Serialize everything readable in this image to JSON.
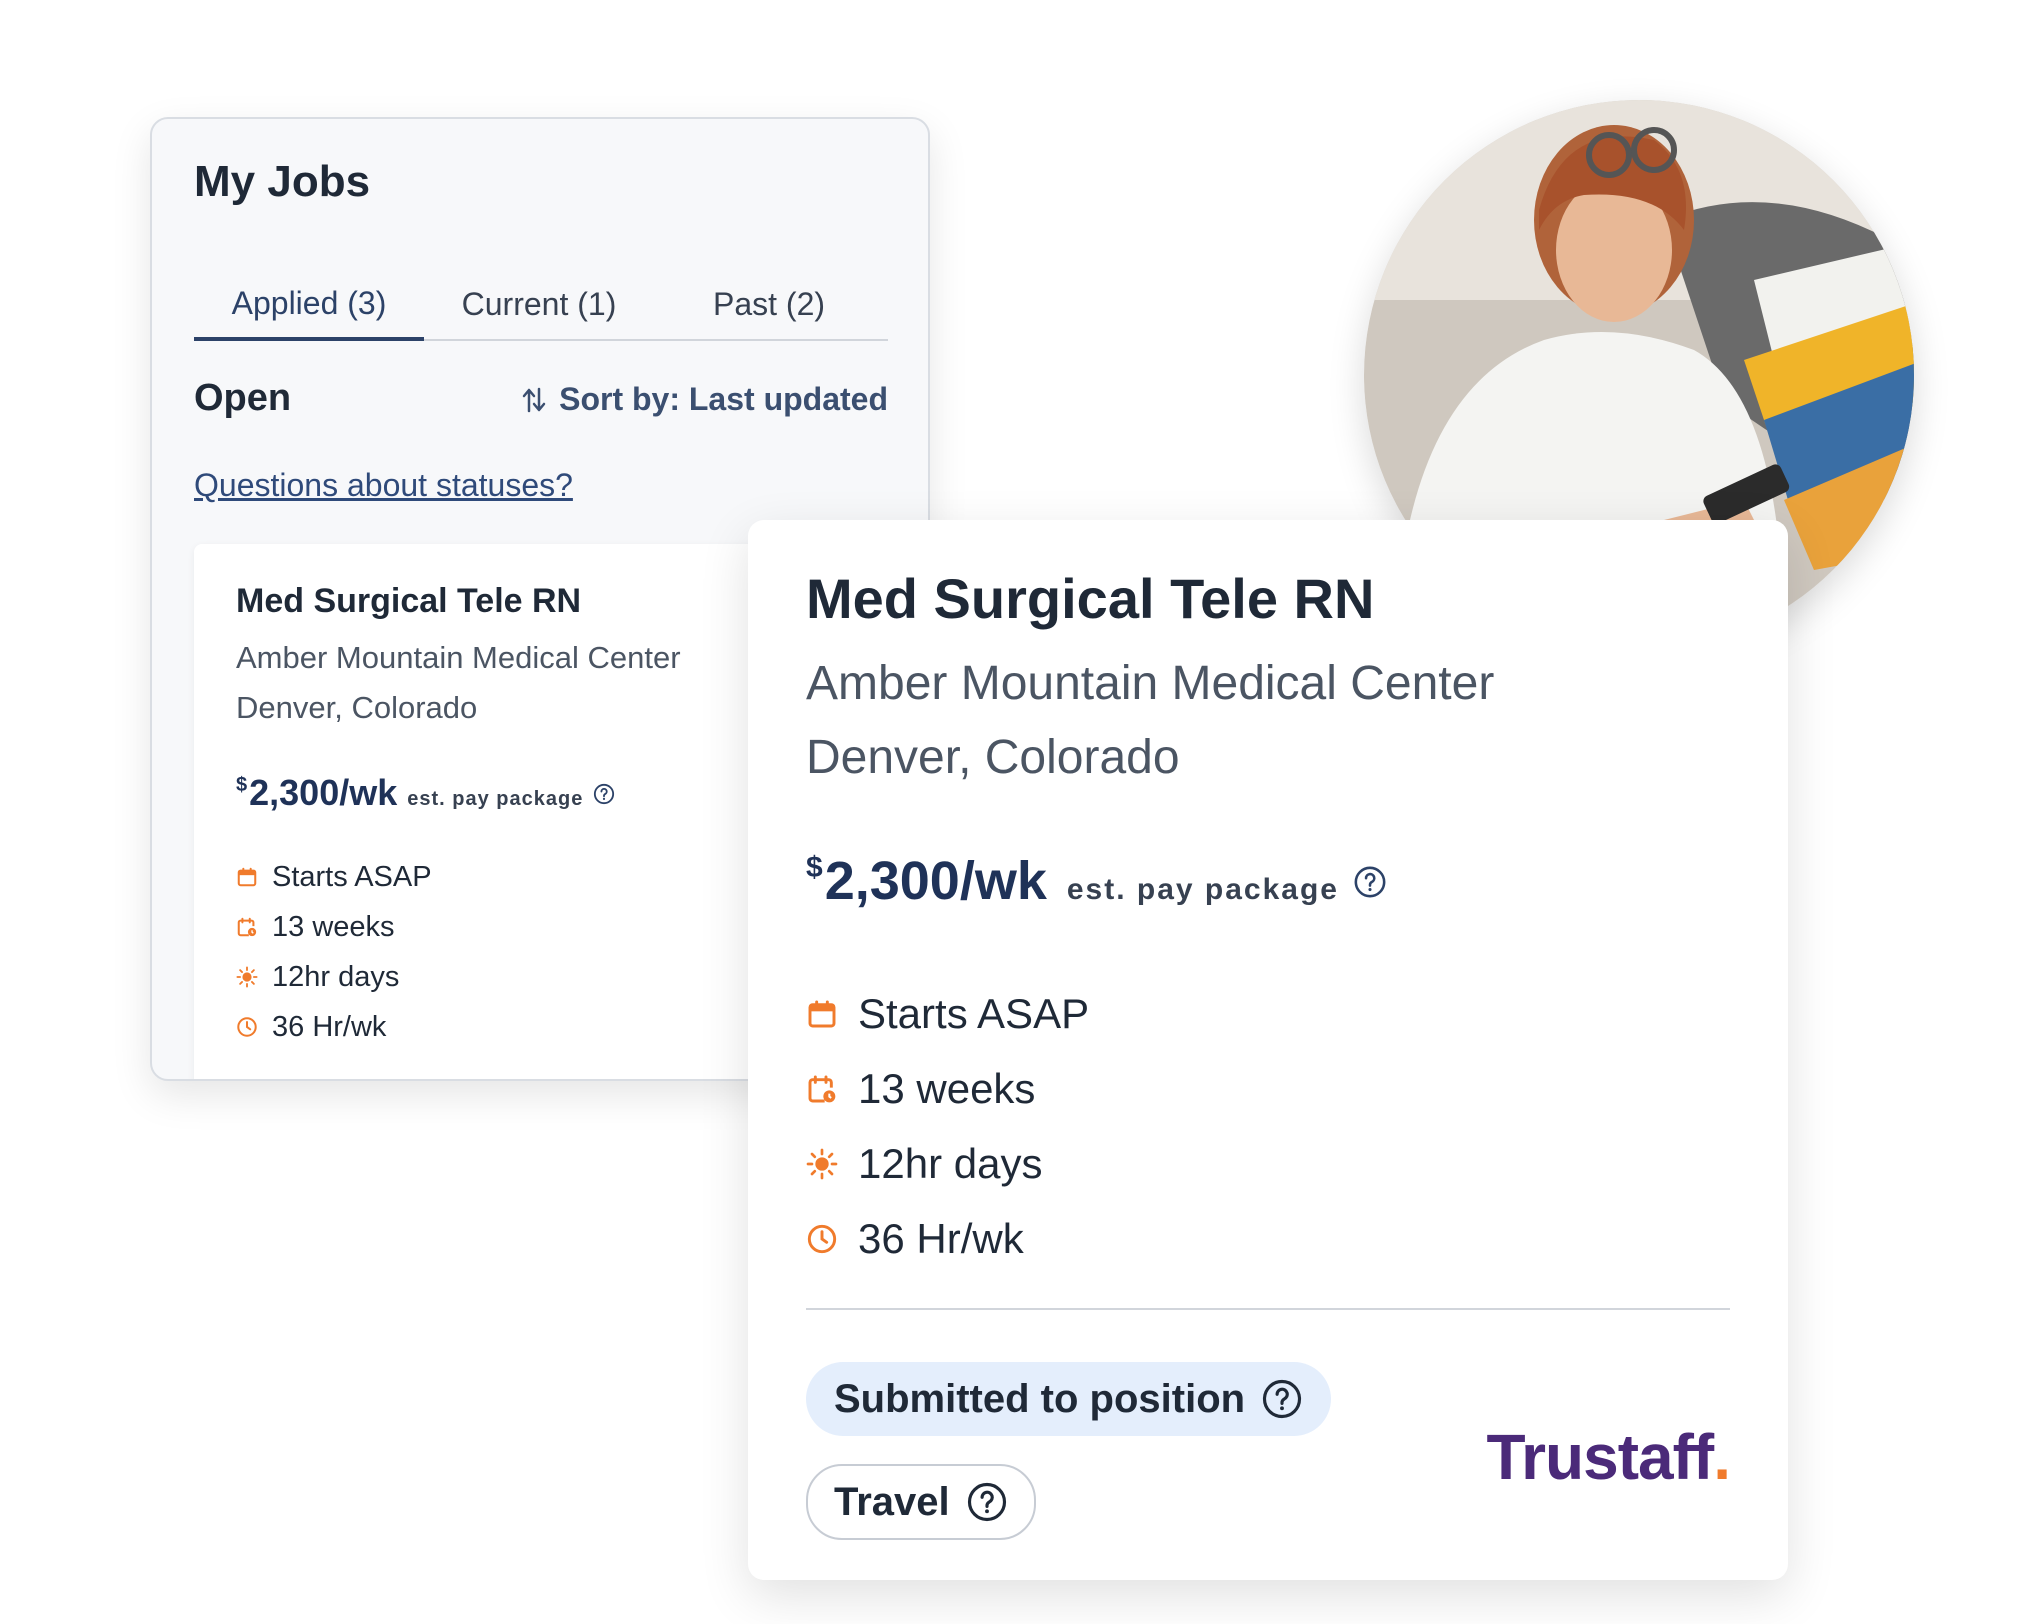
{
  "jobs_panel": {
    "title": "My Jobs",
    "tabs": [
      {
        "label": "Applied (3)",
        "active": true
      },
      {
        "label": "Current (1)",
        "active": false
      },
      {
        "label": "Past (2)",
        "active": false
      }
    ],
    "section_title": "Open",
    "sort_label": "Sort by: Last updated",
    "statuses_link": "Questions about statuses?",
    "job_card": {
      "title": "Med Surgical Tele RN",
      "facility": "Amber Mountain Medical Center",
      "location": "Denver, Colorado",
      "pay_currency": "$",
      "pay_amount": "2,300/wk",
      "pay_label": "est. pay package",
      "features": [
        {
          "icon": "calendar-icon",
          "text": "Starts ASAP"
        },
        {
          "icon": "calendar-clock-icon",
          "text": "13 weeks"
        },
        {
          "icon": "sun-icon",
          "text": "12hr days"
        },
        {
          "icon": "clock-icon",
          "text": "36 Hr/wk"
        }
      ]
    }
  },
  "detail_card": {
    "title": "Med Surgical Tele RN",
    "facility": "Amber Mountain Medical Center",
    "location": "Denver, Colorado",
    "pay_currency": "$",
    "pay_amount": "2,300/wk",
    "pay_label": "est. pay package",
    "features": [
      {
        "icon": "calendar-icon",
        "text": "Starts ASAP"
      },
      {
        "icon": "calendar-clock-icon",
        "text": "13 weeks"
      },
      {
        "icon": "sun-icon",
        "text": "12hr days"
      },
      {
        "icon": "clock-icon",
        "text": "36 Hr/wk"
      }
    ],
    "status_badge": "Submitted to position",
    "type_badge": "Travel",
    "logo_text": "Trustaff",
    "logo_dot": "."
  },
  "colors": {
    "accent_navy": "#2c4268",
    "icon_orange": "#f07b2c",
    "status_bg": "#e4eefc",
    "logo_purple": "#4b2a79"
  }
}
